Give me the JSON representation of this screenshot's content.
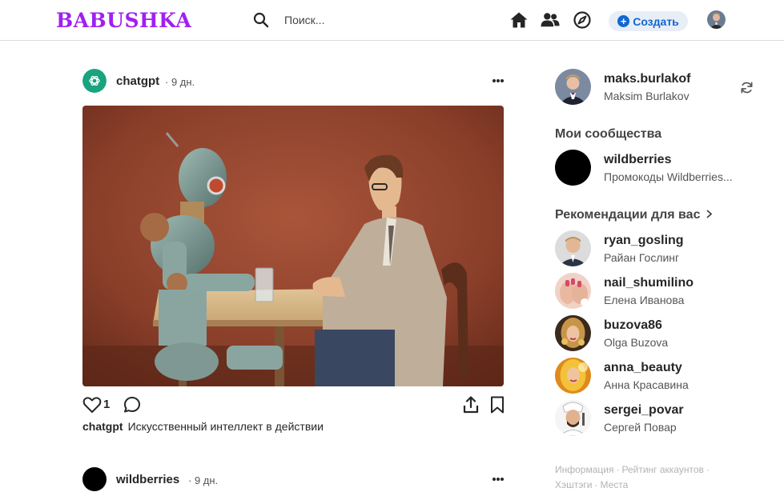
{
  "header": {
    "logo": "BABUSHKA",
    "search_placeholder": "Поиск...",
    "create_label": "Создать",
    "icons": [
      "home-icon",
      "people-icon",
      "compass-icon",
      "plus-icon"
    ]
  },
  "posts": [
    {
      "user": "chatgpt",
      "time": "· 9 дн.",
      "likes": "1",
      "caption_user": "chatgpt",
      "caption_text": "Искусственный интеллект в действии"
    },
    {
      "user": "wildberries",
      "time": "· 9 дн."
    }
  ],
  "sidebar": {
    "profile": {
      "username": "maks.burlakof",
      "full_name": "Maksim Burlakov"
    },
    "communities_title": "Мои сообщества",
    "communities": [
      {
        "name": "wildberries",
        "desc": "Промокоды Wildberries..."
      }
    ],
    "recommendations_title": "Рекомендации для вас",
    "recommendations": [
      {
        "username": "ryan_gosling",
        "name": "Райан Гослинг"
      },
      {
        "username": "nail_shumilino",
        "name": "Елена Иванова"
      },
      {
        "username": "buzova86",
        "name": "Olga Buzova"
      },
      {
        "username": "anna_beauty",
        "name": "Анна Красавина"
      },
      {
        "username": "sergei_povar",
        "name": "Сергей Повар"
      }
    ],
    "footer": [
      "Информация",
      "Рейтинг аккаунтов",
      "Хэштэги",
      "Места"
    ]
  },
  "colors": {
    "brand": "#a020f0",
    "accent": "#1266d4",
    "chatgpt_avatar": "#19a37e"
  }
}
